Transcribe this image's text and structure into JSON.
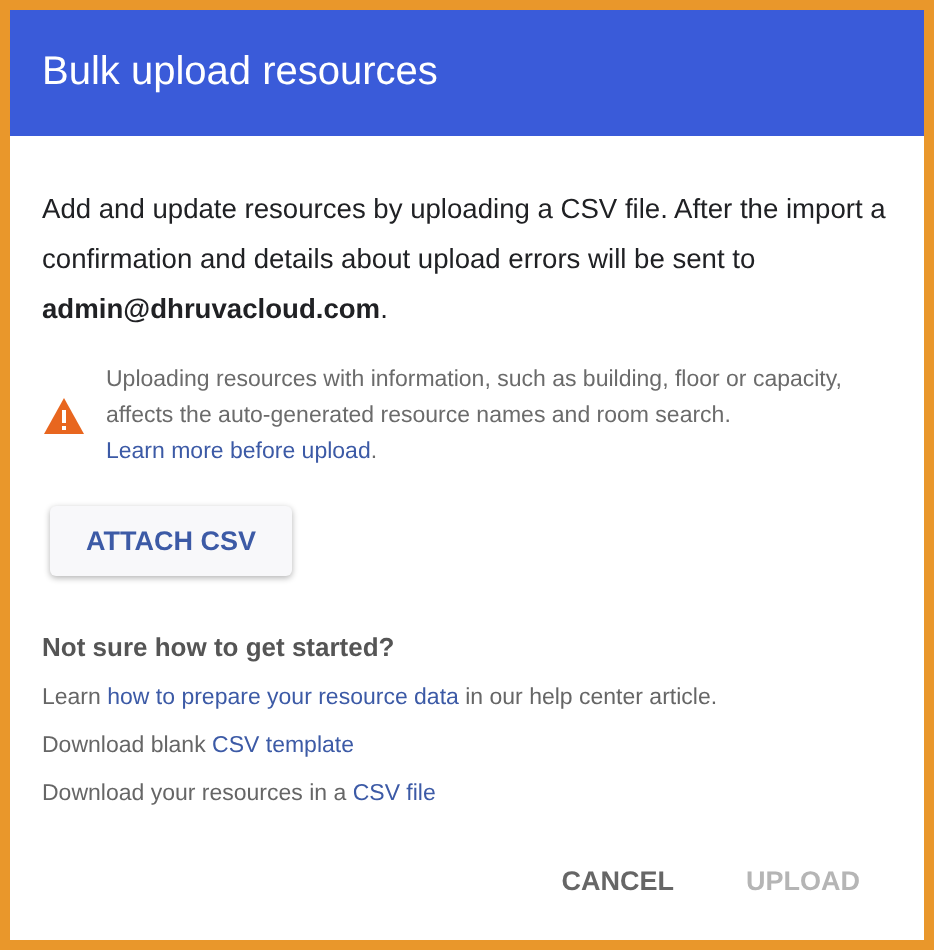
{
  "dialog": {
    "title": "Bulk upload resources",
    "intro": "Add and update resources by uploading a CSV file. After the import a confirmation and details about upload errors will be sent to **admin@dhruvacloud.com**.",
    "warning": {
      "text": "Uploading resources with information, such as building, floor or capacity, affects the auto-generated resource names and room search.",
      "link": "Learn more before upload",
      "after": "."
    },
    "attach_button": "ATTACH CSV",
    "help_heading": "Not sure how to get started?",
    "help_lines": [
      {
        "before": "Learn",
        "link": "how to prepare your resource data",
        "after": "in our help center article."
      },
      {
        "before": "Download blank",
        "link": "CSV template"
      },
      {
        "before": "Download your resources in a",
        "link": "CSV file"
      }
    ],
    "actions": [
      {
        "label": "CANCEL",
        "disabled": false
      },
      {
        "label": "UPLOAD",
        "disabled": true
      }
    ]
  }
}
